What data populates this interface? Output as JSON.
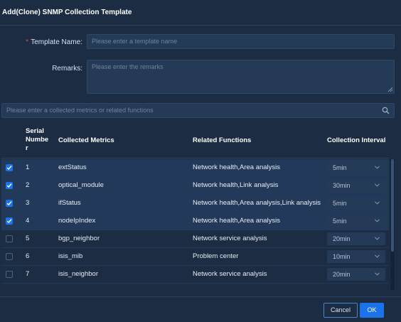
{
  "dialog": {
    "title": "Add(Clone) SNMP Collection Template",
    "template_name_label": "Template Name:",
    "template_name_placeholder": "Please enter a template name",
    "remarks_label": "Remarks:",
    "remarks_placeholder": "Please enter the remarks",
    "search_placeholder": "Please enter a collected metrics or related functions",
    "required_mark": "*"
  },
  "table": {
    "headers": {
      "serial_line1": "Serial",
      "serial_line2": "Numbe",
      "serial_line3": "r",
      "metrics": "Collected Metrics",
      "functions": "Related Functions",
      "interval": "Collection Interval"
    },
    "rows": [
      {
        "checked": true,
        "serial": "1",
        "metric": "extStatus",
        "functions": "Network health,Area analysis",
        "interval": "5min"
      },
      {
        "checked": true,
        "serial": "2",
        "metric": "optical_module",
        "functions": "Network health,Link analysis",
        "interval": "30min"
      },
      {
        "checked": true,
        "serial": "3",
        "metric": "ifStatus",
        "functions": "Network health,Area analysis,Link analysis",
        "interval": "5min"
      },
      {
        "checked": true,
        "serial": "4",
        "metric": "nodeIpIndex",
        "functions": "Network health,Area analysis",
        "interval": "5min"
      },
      {
        "checked": false,
        "serial": "5",
        "metric": "bgp_neighbor",
        "functions": "Network service analysis",
        "interval": "20min"
      },
      {
        "checked": false,
        "serial": "6",
        "metric": "isis_mib",
        "functions": "Problem center",
        "interval": "10min"
      },
      {
        "checked": false,
        "serial": "7",
        "metric": "isis_neighbor",
        "functions": "Network service analysis",
        "interval": "20min"
      }
    ]
  },
  "footer": {
    "cancel_label": "Cancel",
    "ok_label": "OK"
  },
  "colors": {
    "background": "#1b2c43",
    "accent": "#1a73e8",
    "required": "#e5484d"
  }
}
